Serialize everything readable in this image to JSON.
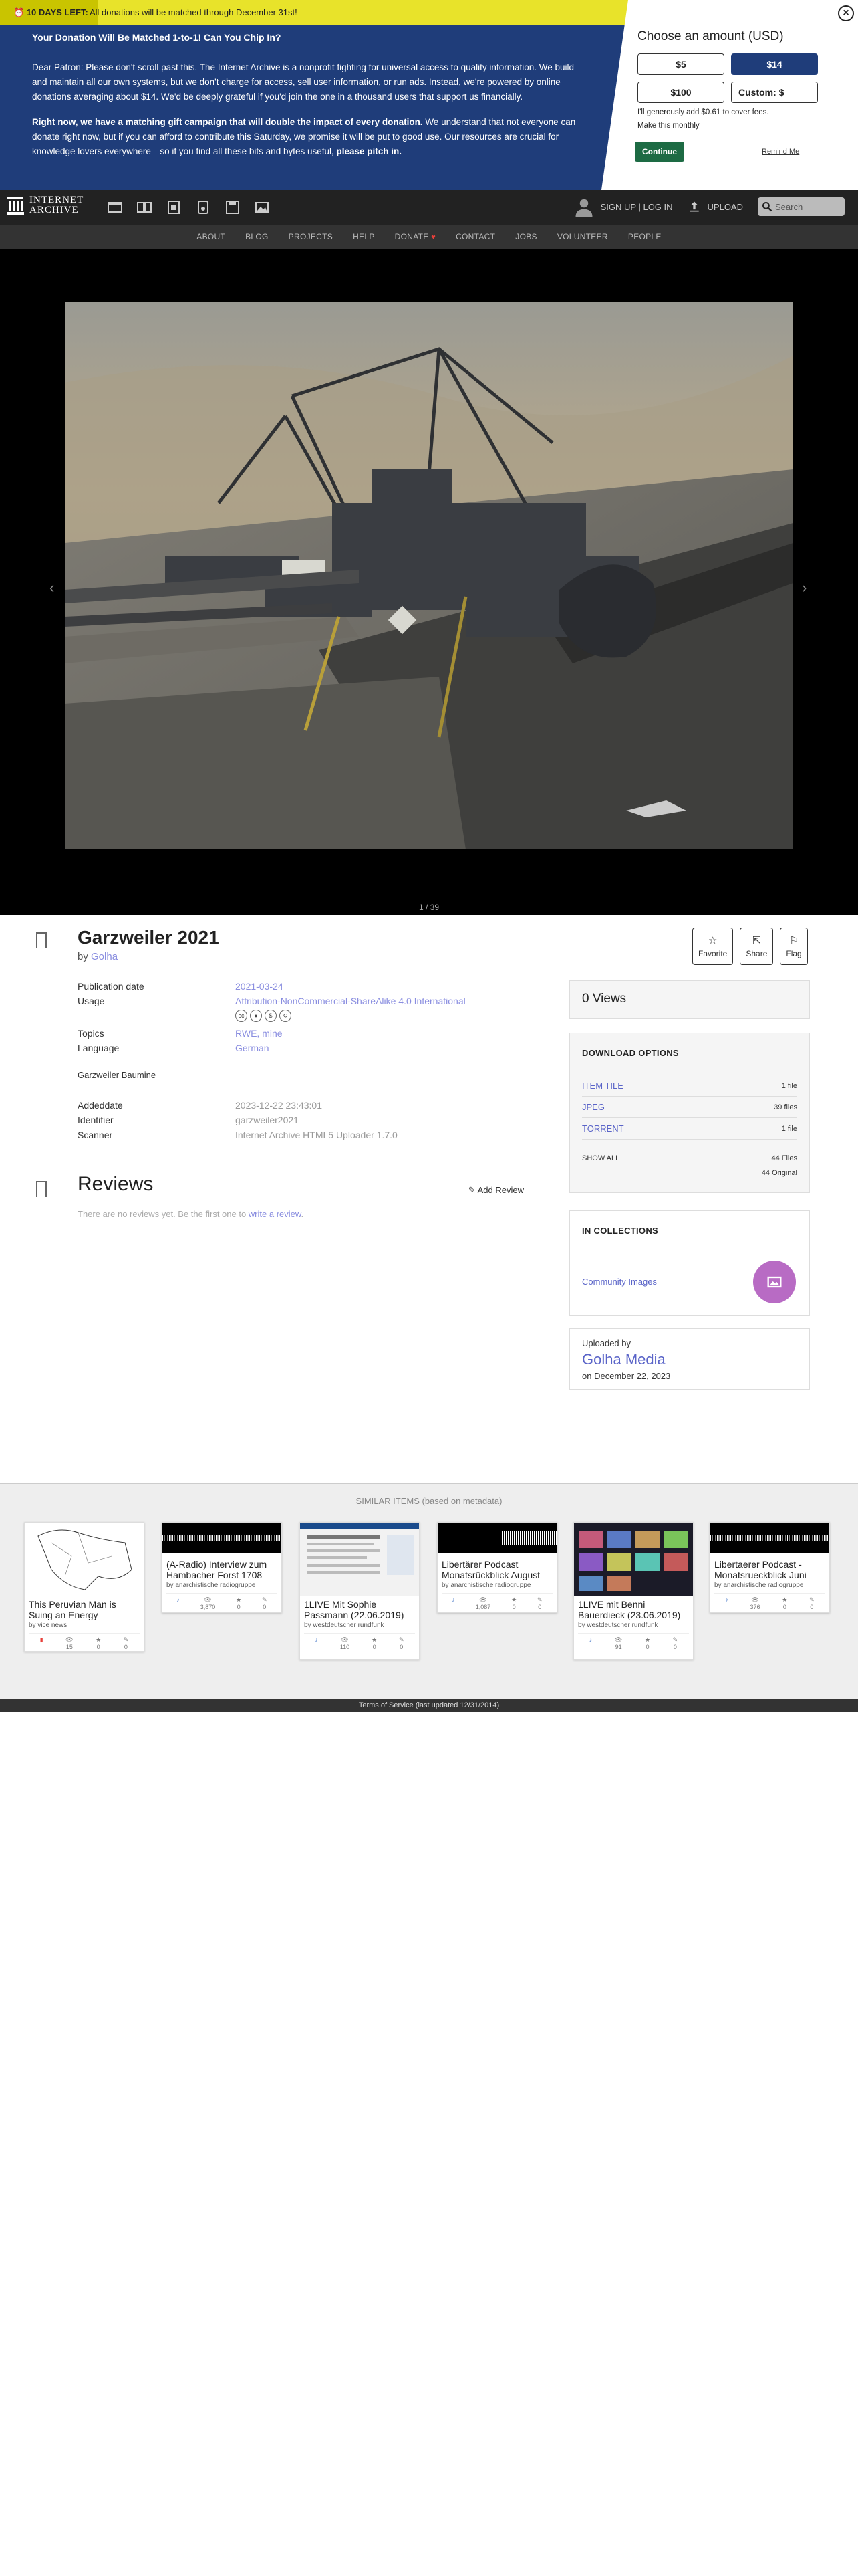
{
  "banner": {
    "badge": "10 DAYS LEFT:",
    "top_message": "All donations will be matched through December 31st!",
    "heading": "Your Donation Will Be Matched 1-to-1! Can You Chip In?",
    "para1": "Dear Patron: Please don't scroll past this. The Internet Archive is a nonprofit fighting for universal access to quality information. We build and maintain all our own systems, but we don't charge for access, sell user information, or run ads. Instead, we're powered by online donations averaging about $14. We'd be deeply grateful if you'd join the one in a thousand users that support us financially.",
    "para2_bold": "Right now, we have a matching gift campaign that will double the impact of every donation.",
    "para2_rest": " We understand that not everyone can donate right now, but if you can afford to contribute this Saturday, we promise it will be put to good use. Our resources are crucial for knowledge lovers everywhere—so if you find all these bits and bytes useful, ",
    "para2_end": "please pitch in.",
    "choose": "Choose an amount (USD)",
    "amounts": [
      "$5",
      "$14",
      "$100",
      "Custom: $"
    ],
    "cover_fees": "I'll generously add $0.61 to cover fees.",
    "monthly": "Make this monthly",
    "continue": "Continue",
    "remind": "Remind Me",
    "close": "×"
  },
  "topnav": {
    "logo_line1": "INTERNET",
    "logo_line2": "ARCHIVE",
    "signup": "SIGN UP | LOG IN",
    "upload": "UPLOAD",
    "search_placeholder": "Search"
  },
  "subnav": [
    "ABOUT",
    "BLOG",
    "PROJECTS",
    "HELP",
    "DONATE",
    "CONTACT",
    "JOBS",
    "VOLUNTEER",
    "PEOPLE"
  ],
  "theater": {
    "counter": "1 / 39"
  },
  "item": {
    "title": "Garzweiler 2021",
    "by_label": "by ",
    "author": "Golha",
    "favorite": "Favorite",
    "share": "Share",
    "flag": "Flag",
    "meta1": [
      {
        "k": "Publication date",
        "v": "2021-03-24"
      },
      {
        "k": "Usage",
        "v": "Attribution-NonCommercial-ShareAlike 4.0 International"
      }
    ],
    "meta2": [
      {
        "k": "Topics",
        "v": "RWE, mine"
      },
      {
        "k": "Language",
        "v": "German"
      }
    ],
    "description": "Garzweiler Baumine",
    "meta3": [
      {
        "k": "Addeddate",
        "v": "2023-12-22 23:43:01"
      },
      {
        "k": "Identifier",
        "v": "garzweiler2021"
      },
      {
        "k": "Scanner",
        "v": "Internet Archive HTML5 Uploader 1.7.0"
      }
    ]
  },
  "reviews": {
    "title": "Reviews",
    "add": "Add Review",
    "empty_prefix": "There are no reviews yet. Be the first one to ",
    "empty_link": "write a review",
    "empty_suffix": "."
  },
  "sidebar": {
    "views": "0 Views",
    "download_title": "DOWNLOAD OPTIONS",
    "downloads": [
      {
        "name": "ITEM TILE",
        "count": "1 file"
      },
      {
        "name": "JPEG",
        "count": "39 files"
      },
      {
        "name": "TORRENT",
        "count": "1 file"
      }
    ],
    "show_all": "SHOW ALL",
    "total_files": "44 Files",
    "original": "44 Original",
    "collections_title": "IN COLLECTIONS",
    "collection": "Community Images",
    "uploaded_by": "Uploaded by",
    "uploader": "Golha Media",
    "upload_date": "on December 22, 2023"
  },
  "similar": {
    "header": "SIMILAR ITEMS (based on metadata)",
    "cards": [
      {
        "title": "This Peruvian Man is Suing an Energy",
        "by": "by vice news",
        "s1": "15",
        "s2": "0",
        "s3": "0"
      },
      {
        "title": "(A-Radio) Interview zum Hambacher Forst  1708",
        "by": "by anarchistische radiogruppe",
        "s1": "3,870",
        "s2": "0",
        "s3": "0"
      },
      {
        "title": "1LIVE Mit Sophie Passmann (22.06.2019)",
        "by": "by westdeutscher rundfunk",
        "s1": "110",
        "s2": "0",
        "s3": "0"
      },
      {
        "title": "Libertärer Podcast Monatsrückblick August",
        "by": "by anarchistische radiogruppe",
        "s1": "1,087",
        "s2": "0",
        "s3": "0"
      },
      {
        "title": "1LIVE mit Benni Bauerdieck (23.06.2019)",
        "by": "by westdeutscher rundfunk",
        "s1": "91",
        "s2": "0",
        "s3": "0"
      },
      {
        "title": "Libertaerer Podcast - Monatsrueckblick Juni",
        "by": "by anarchistische radiogruppe",
        "s1": "376",
        "s2": "0",
        "s3": "0"
      }
    ]
  },
  "footer": "Terms of Service (last updated 12/31/2014)"
}
